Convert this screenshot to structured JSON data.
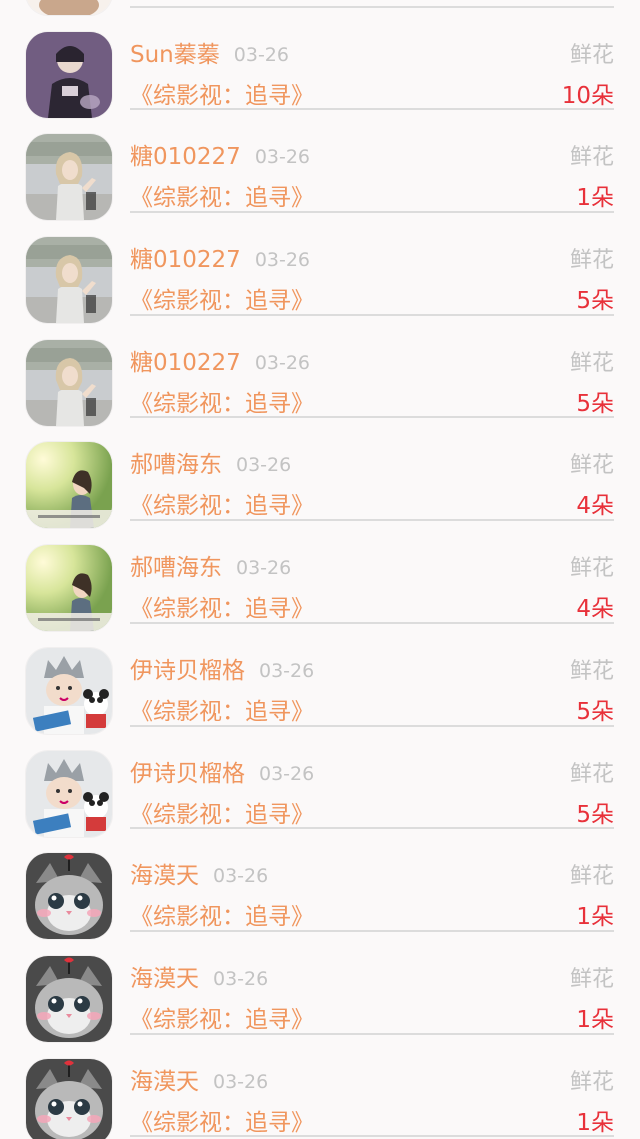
{
  "gift_list": {
    "items": [
      {
        "username": "",
        "date": "",
        "program": "",
        "gift": "",
        "count": "",
        "avatar": "partial-top"
      },
      {
        "username": "Sun蓁蓁",
        "date": "03-26",
        "program": "《综影视：追寻》",
        "gift": "鲜花",
        "count": "10朵",
        "avatar": "dark-portrait"
      },
      {
        "username": "糖010227",
        "date": "03-26",
        "program": "《综影视：追寻》",
        "gift": "鲜花",
        "count": "1朵",
        "avatar": "street-girl"
      },
      {
        "username": "糖010227",
        "date": "03-26",
        "program": "《综影视：追寻》",
        "gift": "鲜花",
        "count": "5朵",
        "avatar": "street-girl"
      },
      {
        "username": "糖010227",
        "date": "03-26",
        "program": "《综影视：追寻》",
        "gift": "鲜花",
        "count": "5朵",
        "avatar": "street-girl"
      },
      {
        "username": "郝嘈海东",
        "date": "03-26",
        "program": "《综影视：追寻》",
        "gift": "鲜花",
        "count": "4朵",
        "avatar": "sunlit-girl"
      },
      {
        "username": "郝嘈海东",
        "date": "03-26",
        "program": "《综影视：追寻》",
        "gift": "鲜花",
        "count": "4朵",
        "avatar": "sunlit-girl"
      },
      {
        "username": "伊诗贝榴格",
        "date": "03-26",
        "program": "《综影视：追寻》",
        "gift": "鲜花",
        "count": "5朵",
        "avatar": "child-crown"
      },
      {
        "username": "伊诗贝榴格",
        "date": "03-26",
        "program": "《综影视：追寻》",
        "gift": "鲜花",
        "count": "5朵",
        "avatar": "child-crown"
      },
      {
        "username": "海漠天",
        "date": "03-26",
        "program": "《综影视：追寻》",
        "gift": "鲜花",
        "count": "1朵",
        "avatar": "cat"
      },
      {
        "username": "海漠天",
        "date": "03-26",
        "program": "《综影视：追寻》",
        "gift": "鲜花",
        "count": "1朵",
        "avatar": "cat"
      },
      {
        "username": "海漠天",
        "date": "03-26",
        "program": "《综影视：追寻》",
        "gift": "鲜花",
        "count": "1朵",
        "avatar": "cat"
      }
    ]
  },
  "colors": {
    "accent": "#f0965e",
    "count": "#e8313a",
    "muted": "#c3c3c3",
    "divider": "#dcdcdc",
    "background": "#fbf9f9"
  }
}
